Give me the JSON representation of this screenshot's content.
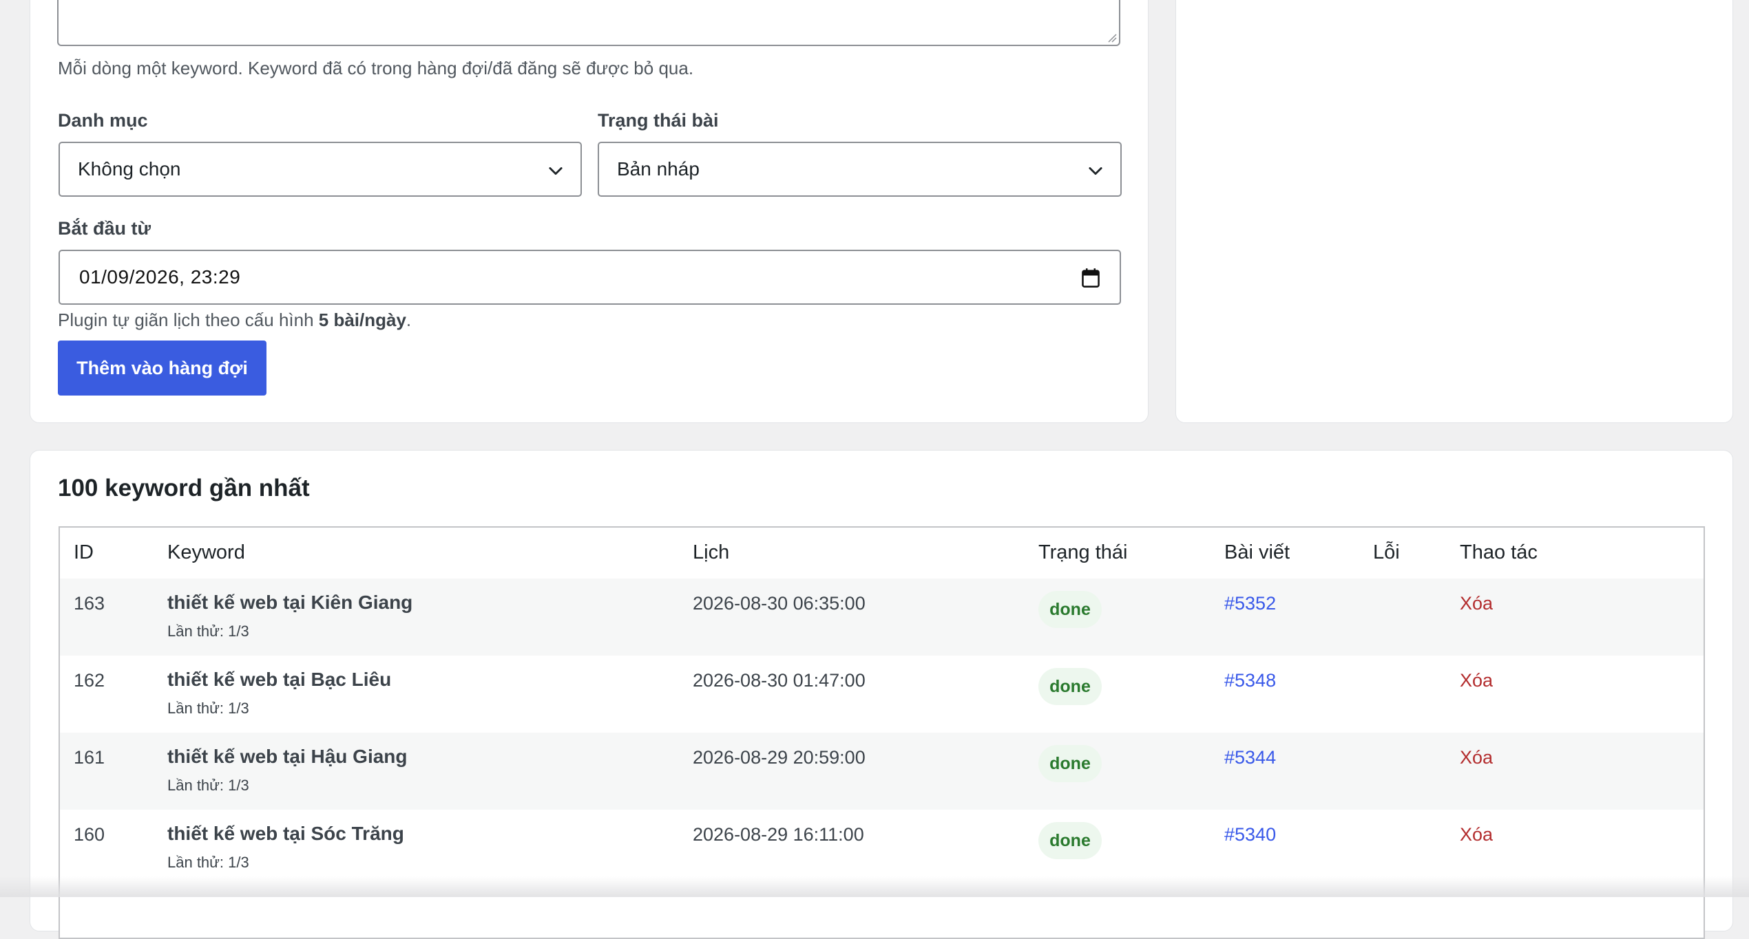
{
  "form": {
    "keywords_help": "Mỗi dòng một keyword. Keyword đã có trong hàng đợi/đã đăng sẽ được bỏ qua.",
    "category_label": "Danh mục",
    "category_value": "Không chọn",
    "post_status_label": "Trạng thái bài",
    "post_status_value": "Bản nháp",
    "start_label": "Bắt đầu từ",
    "start_value": "01/09/2026, 23:29",
    "schedule_help_prefix": "Plugin tự giãn lịch theo cấu hình ",
    "schedule_help_bold": "5 bài/ngày",
    "schedule_help_suffix": ".",
    "submit_label": "Thêm vào hàng đợi"
  },
  "queue": {
    "title": "100 keyword gần nhất",
    "columns": [
      "ID",
      "Keyword",
      "Lịch",
      "Trạng thái",
      "Bài viết",
      "Lỗi",
      "Thao tác"
    ],
    "rows": [
      {
        "id": "163",
        "keyword": "thiết kế web tại Kiên Giang",
        "attempt": "Lần thử: 1/3",
        "schedule": "2026-08-30 06:35:00",
        "status": "done",
        "post": "#5352",
        "error": "",
        "action": "Xóa"
      },
      {
        "id": "162",
        "keyword": "thiết kế web tại Bạc Liêu",
        "attempt": "Lần thử: 1/3",
        "schedule": "2026-08-30 01:47:00",
        "status": "done",
        "post": "#5348",
        "error": "",
        "action": "Xóa"
      },
      {
        "id": "161",
        "keyword": "thiết kế web tại Hậu Giang",
        "attempt": "Lần thử: 1/3",
        "schedule": "2026-08-29 20:59:00",
        "status": "done",
        "post": "#5344",
        "error": "",
        "action": "Xóa"
      },
      {
        "id": "160",
        "keyword": "thiết kế web tại Sóc Trăng",
        "attempt": "Lần thử: 1/3",
        "schedule": "2026-08-29 16:11:00",
        "status": "done",
        "post": "#5340",
        "error": "",
        "action": "Xóa"
      }
    ]
  },
  "colors": {
    "primary": "#3a5ce0",
    "link": "#3858e9",
    "danger": "#b32d2e",
    "done_bg": "#edf7ee",
    "done_text": "#2a7a2e"
  }
}
